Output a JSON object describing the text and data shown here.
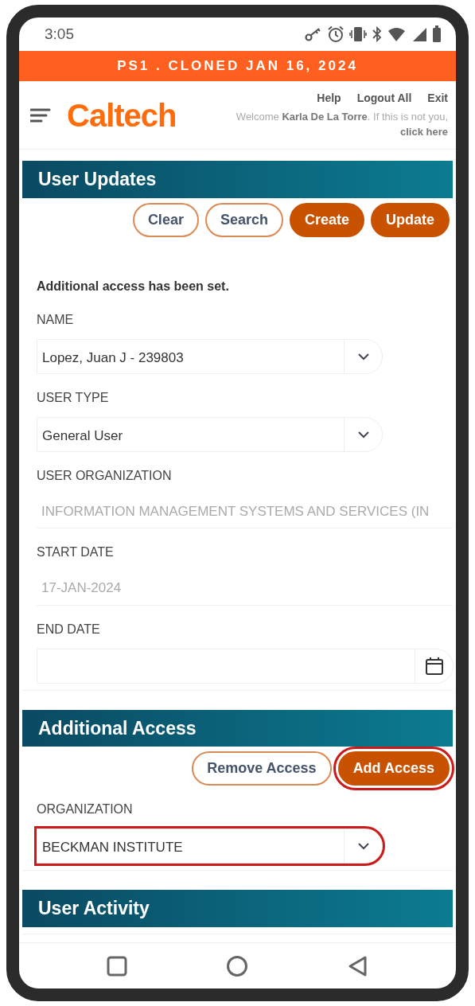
{
  "status_bar": {
    "time": "3:05"
  },
  "banner": {
    "text": "PS1 . CLONED JAN 16, 2024"
  },
  "header": {
    "logo": "Caltech",
    "links": [
      "Help",
      "Logout All",
      "Exit"
    ],
    "welcome": "Welcome **Karla De La Torre**. If this is not you,",
    "welcome_link": "click here"
  },
  "sections": [
    {
      "title": "User Updates",
      "buttons": [
        {
          "label": "Clear",
          "kind": "outline",
          "highlighted": false
        },
        {
          "label": "Search",
          "kind": "outline",
          "highlighted": false
        },
        {
          "label": "Create",
          "kind": "filled",
          "highlighted": false
        },
        {
          "label": "Update",
          "kind": "filled",
          "highlighted": false
        }
      ],
      "message": "Additional access has been set.",
      "fields": [
        {
          "label": "NAME",
          "kind": "select",
          "value": "Lopez, Juan J - 239803",
          "highlighted": false
        },
        {
          "label": "USER TYPE",
          "kind": "select",
          "value": "General User",
          "highlighted": false
        },
        {
          "label": "USER ORGANIZATION",
          "kind": "readonly",
          "value": "INFORMATION MANAGEMENT SYSTEMS AND SERVICES (IN"
        },
        {
          "label": "START DATE",
          "kind": "readonly",
          "value": "17-JAN-2024"
        },
        {
          "label": "END DATE",
          "kind": "date"
        }
      ]
    },
    {
      "title": "Additional Access",
      "buttons": [
        {
          "label": "Remove Access",
          "kind": "outline",
          "highlighted": false
        },
        {
          "label": "Add Access",
          "kind": "filled",
          "highlighted": true
        }
      ],
      "fields": [
        {
          "label": "ORGANIZATION",
          "kind": "select",
          "value": "BECKMAN INSTITUTE",
          "highlighted": true
        }
      ]
    },
    {
      "title": "User Activity"
    }
  ]
}
